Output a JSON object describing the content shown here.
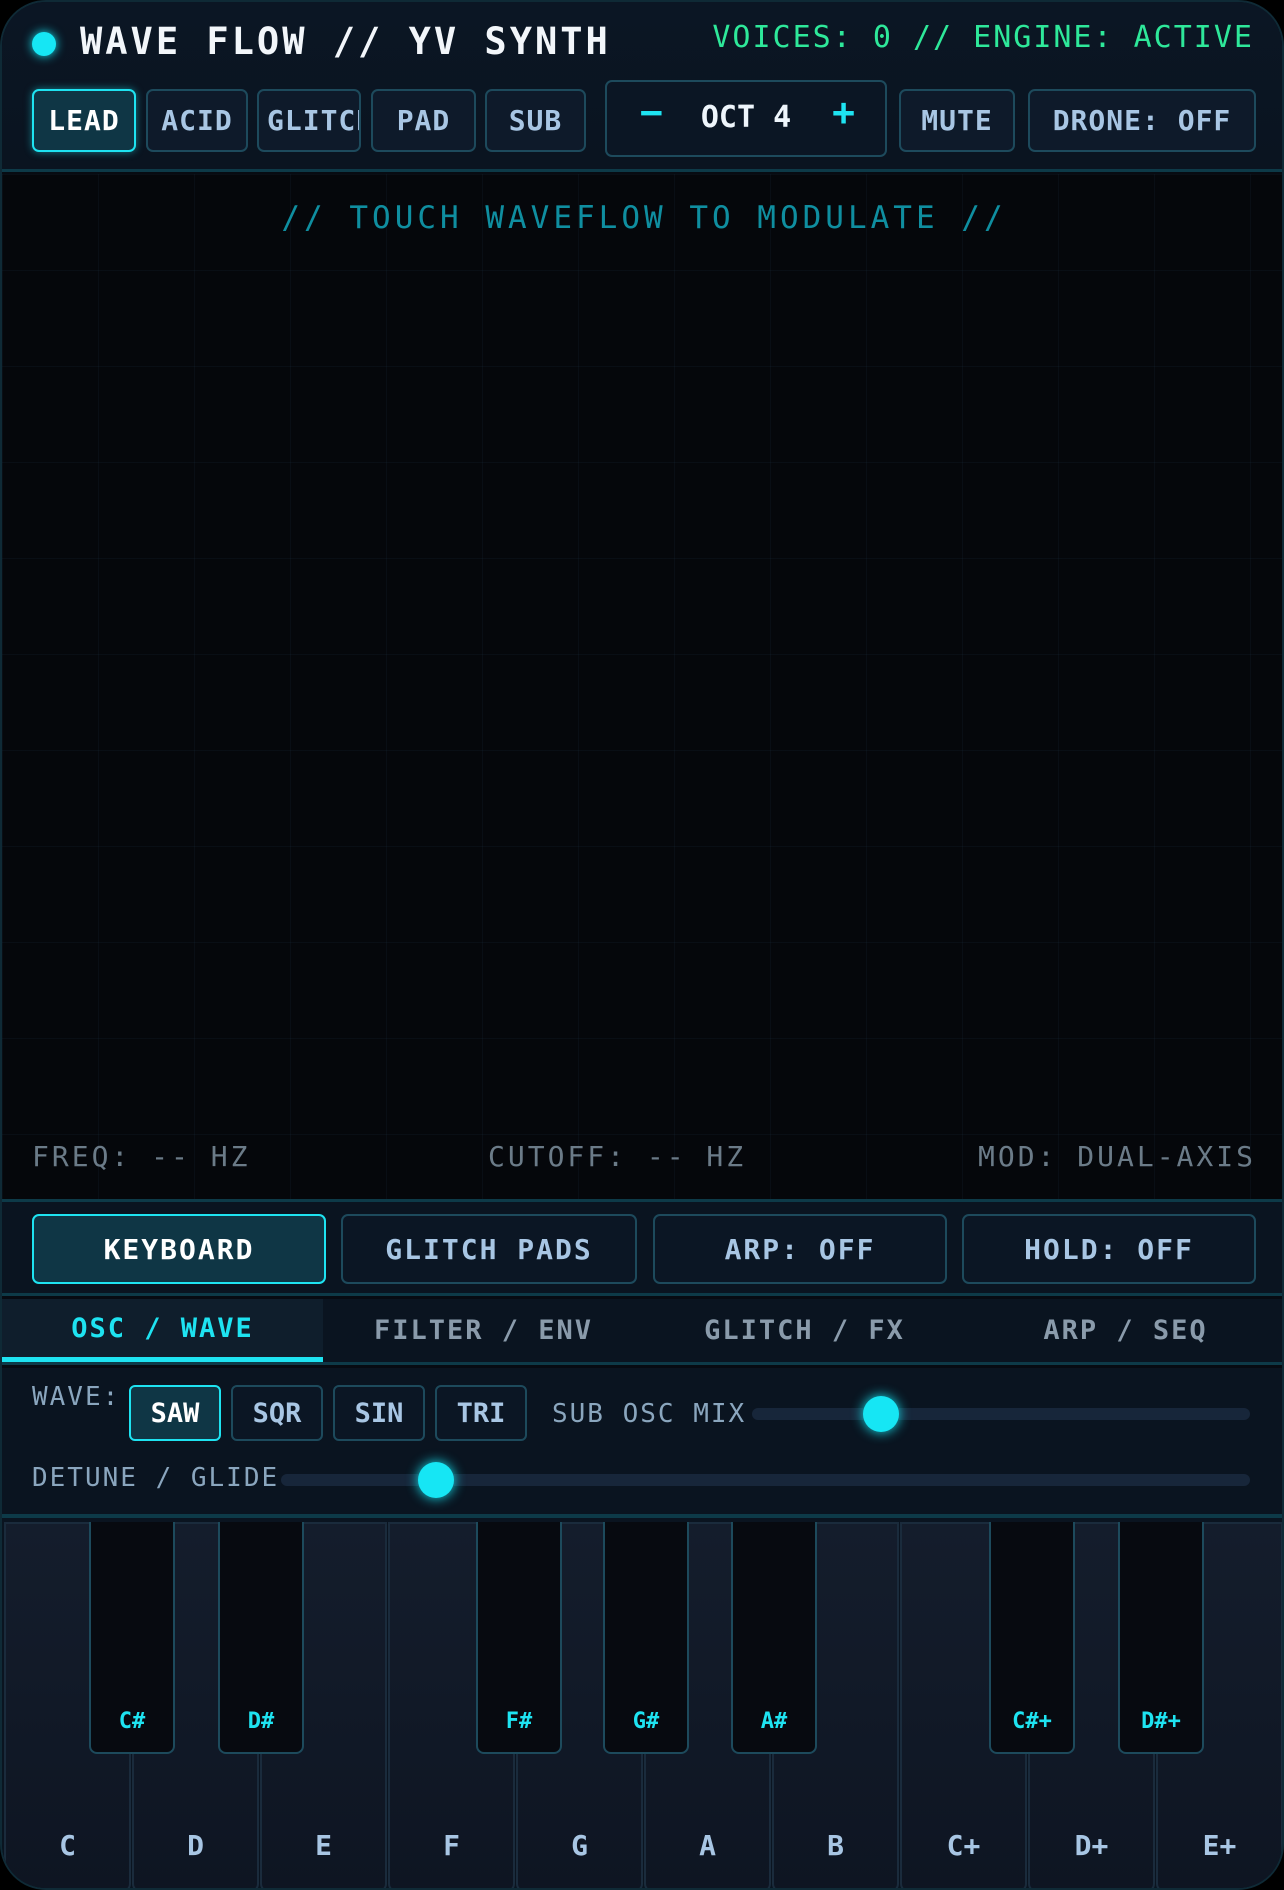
{
  "header": {
    "title": "WAVE FLOW // YV SYNTH",
    "status": "VOICES: 0 // ENGINE: ACTIVE",
    "presets": [
      "LEAD",
      "ACID",
      "GLITCH",
      "PAD",
      "SUB"
    ],
    "active_preset": "LEAD",
    "octave": {
      "minus": "−",
      "label": "OCT 4",
      "plus": "+"
    },
    "mute_label": "MUTE",
    "drone_label": "DRONE: OFF"
  },
  "waveflow": {
    "hint": "// TOUCH WAVEFLOW TO MODULATE //",
    "freq": "FREQ: -- HZ",
    "cutoff": "CUTOFF: -- HZ",
    "mod": "MOD: DUAL-AXIS"
  },
  "modes": {
    "keyboard": "KEYBOARD",
    "glitch_pads": "GLITCH PADS",
    "arp": "ARP: OFF",
    "hold": "HOLD: OFF",
    "active": "KEYBOARD"
  },
  "tabs": [
    "OSC / WAVE",
    "FILTER / ENV",
    "GLITCH / FX",
    "ARP / SEQ"
  ],
  "active_tab": "OSC / WAVE",
  "controls": {
    "wave_label": "WAVE:",
    "waves": [
      "SAW",
      "SQR",
      "SIN",
      "TRI"
    ],
    "active_wave": "SAW",
    "sub_osc_label": "SUB OSC MIX",
    "sub_osc_value": 0.26,
    "detune_label": "DETUNE / GLIDE",
    "detune_value": 0.16
  },
  "keyboard": {
    "white_keys": [
      "C",
      "D",
      "E",
      "F",
      "G",
      "A",
      "B",
      "C+",
      "D+",
      "E+"
    ],
    "black_keys": [
      "C#",
      "D#",
      "F#",
      "G#",
      "A#",
      "C#+",
      "D#+"
    ]
  },
  "colors": {
    "accent": "#1ee3f1",
    "status": "#2ee89a",
    "background": "#070b12"
  }
}
